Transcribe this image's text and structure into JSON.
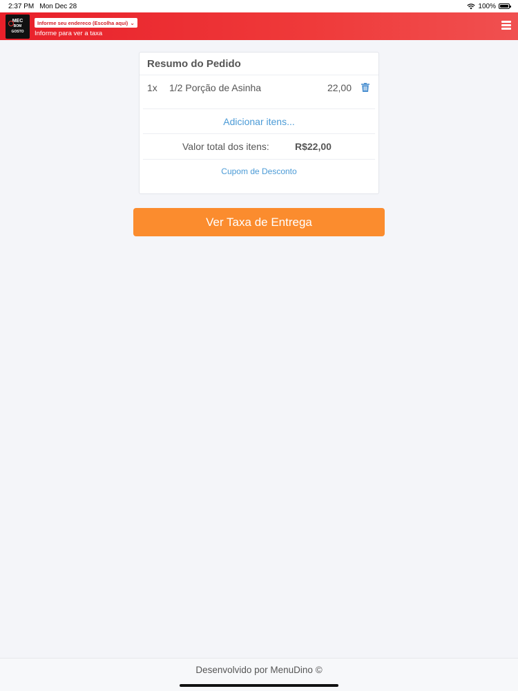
{
  "status_bar": {
    "time": "2:37 PM",
    "date": "Mon Dec 28",
    "battery": "100%"
  },
  "header": {
    "logo_text": "MEC\nBOM\nGOSTO",
    "address_select": "Informe seu endereco (Escolha aqui)",
    "address_hint": "Informe para ver a taxa",
    "accent_color": "#e8202a"
  },
  "order": {
    "title": "Resumo do Pedido",
    "items": [
      {
        "qty": "1x",
        "name": "1/2 Porção de Asinha",
        "price": "22,00"
      }
    ],
    "add_items": "Adicionar itens...",
    "total_label": "Valor total dos itens:",
    "total_value": "R$22,00",
    "coupon": "Cupom de Desconto"
  },
  "cta": {
    "label": "Ver Taxa de Entrega",
    "color": "#fb8c2e"
  },
  "footer": {
    "text": "Desenvolvido por MenuDino ©"
  }
}
